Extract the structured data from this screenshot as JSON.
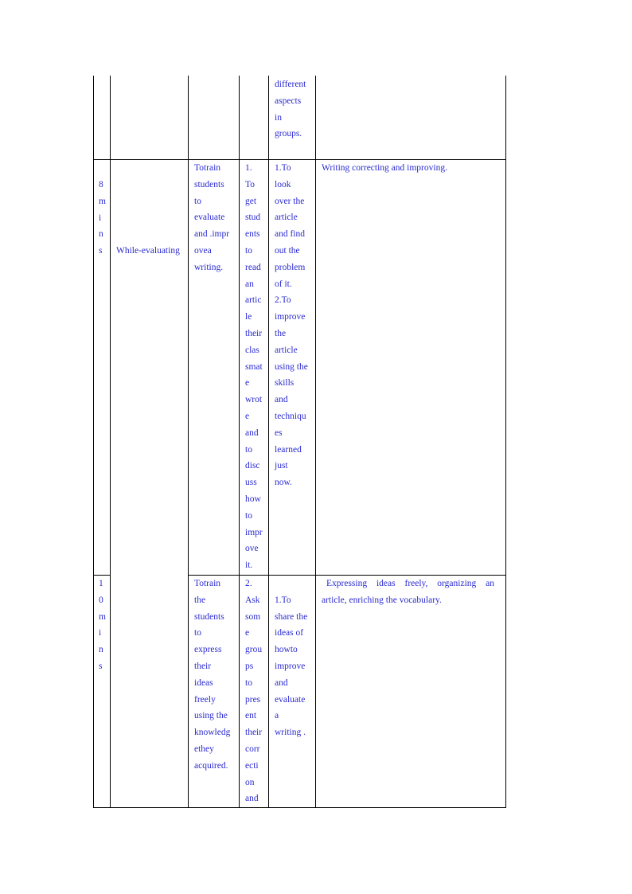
{
  "document": {
    "text_color": "#2a2ad0",
    "rows": [
      {
        "time": [],
        "stage": "",
        "aim": [],
        "activity": [],
        "procedure": [
          "different",
          "aspects",
          "in",
          "groups."
        ],
        "skills": ""
      },
      {
        "time": [
          "8",
          "m",
          "i",
          "n",
          "s"
        ],
        "stage": "While-evaluating",
        "aim": [
          "To  train",
          "students",
          "to",
          "evaluate",
          "and .impr",
          "ove  a",
          "writing."
        ],
        "activity": [
          "1.",
          "To",
          "get",
          "stud",
          "ents",
          "to",
          "read",
          "an",
          "artic",
          "le",
          "their",
          "clas",
          "smat",
          "e",
          "wrot",
          "e",
          "and",
          "to",
          "disc",
          "uss",
          "how",
          "to",
          "impr",
          "ove",
          "it."
        ],
        "procedure": [
          "1.  To",
          "look",
          "over the",
          "article",
          "and find",
          "out the",
          "problem",
          "of it.",
          "2.  To",
          "improve",
          "the",
          "article",
          "using the",
          "skills",
          "and",
          "techniqu",
          "es",
          "learned",
          "just",
          "now."
        ],
        "skills": "Writing correcting and improving."
      },
      {
        "time": [
          "1",
          "0",
          "m",
          "i",
          "n",
          "s"
        ],
        "stage": "",
        "aim": [
          "To  train",
          "the",
          "students",
          "to",
          "express",
          "their",
          "ideas",
          "freely",
          "using the",
          "knowledg",
          "e  they",
          "acquired."
        ],
        "activity": [
          "2.",
          "Ask",
          "som",
          "e",
          "grou",
          "ps",
          "to",
          "pres",
          "ent",
          "their",
          "corr",
          "ecti",
          "on",
          "and"
        ],
        "procedure": [
          "",
          "1.  To",
          "share the",
          "ideas of",
          "how  to",
          "improve",
          "and",
          "evaluate",
          "a",
          "writing ."
        ],
        "skills_lines": [
          "Expressing  ideas  freely,  organizing  an",
          "article, enriching the vocabulary."
        ]
      }
    ]
  }
}
